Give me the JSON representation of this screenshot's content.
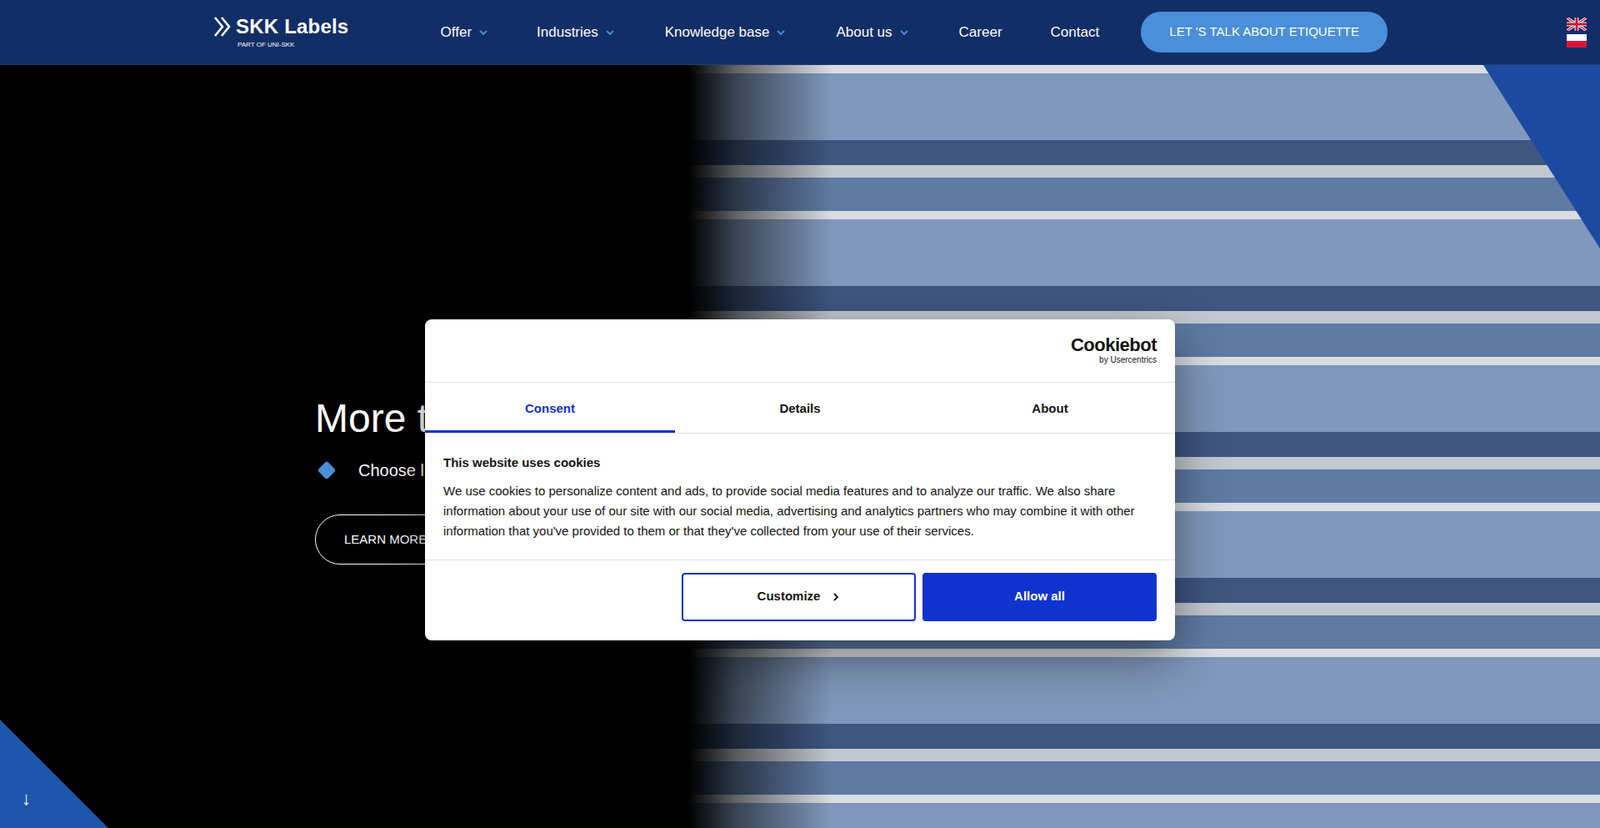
{
  "header": {
    "logo": "SKK Labels",
    "logo_sub": "PART OF UNI-SKK",
    "nav": [
      {
        "label": "Offer",
        "dropdown": true
      },
      {
        "label": "Industries",
        "dropdown": true
      },
      {
        "label": "Knowledge base",
        "dropdown": true
      },
      {
        "label": "About us",
        "dropdown": true
      },
      {
        "label": "Career",
        "dropdown": false
      },
      {
        "label": "Contact",
        "dropdown": false
      }
    ],
    "cta": "LET 'S TALK ABOUT ETIQUETTE"
  },
  "hero": {
    "title": "More t",
    "bullet": "Choose l",
    "button": "LEARN MORE",
    "scroll": "↓"
  },
  "cookie_dialog": {
    "brand": "Cookiebot",
    "brand_sub": "by Usercentrics",
    "tabs": [
      {
        "label": "Consent",
        "selected": true
      },
      {
        "label": "Details",
        "selected": false
      },
      {
        "label": "About",
        "selected": false
      }
    ],
    "heading": "This website uses cookies",
    "text": "We use cookies to personalize content and ads, to provide social media features and to analyze our traffic. We also share information about your use of our site with our social media, advertising and analytics partners who may combine it with other information that you've provided to them or that they've collected from your use of their services.",
    "buttons": [
      {
        "label": "Customize",
        "kind": "outline"
      },
      {
        "label": "Allow all",
        "kind": "primary"
      }
    ]
  }
}
